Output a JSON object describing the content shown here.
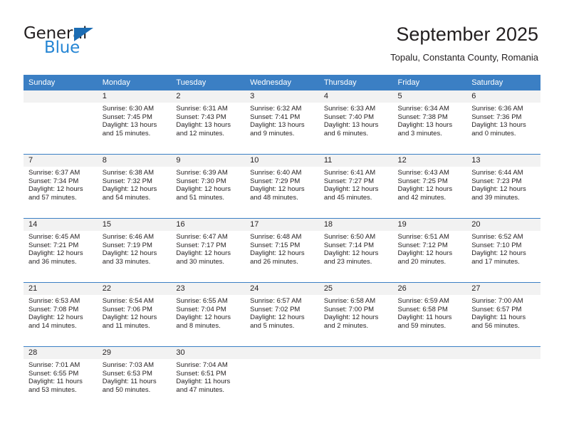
{
  "brand": {
    "name_part1": "General",
    "name_part2": "Blue",
    "accent_color": "#2585d4",
    "triangle_color": "#1b6cb3"
  },
  "header": {
    "title": "September 2025",
    "location": "Topalu, Constanta County, Romania"
  },
  "theme": {
    "header_blue": "#3b7fc4",
    "daynum_band": "#f2f2f2",
    "text": "#231f20"
  },
  "calendar": {
    "weekday_headers": [
      "Sunday",
      "Monday",
      "Tuesday",
      "Wednesday",
      "Thursday",
      "Friday",
      "Saturday"
    ],
    "weeks": [
      [
        {
          "day": "",
          "sunrise": "",
          "sunset": "",
          "daylight": "",
          "empty": true
        },
        {
          "day": "1",
          "sunrise": "Sunrise: 6:30 AM",
          "sunset": "Sunset: 7:45 PM",
          "daylight": "Daylight: 13 hours and 15 minutes."
        },
        {
          "day": "2",
          "sunrise": "Sunrise: 6:31 AM",
          "sunset": "Sunset: 7:43 PM",
          "daylight": "Daylight: 13 hours and 12 minutes."
        },
        {
          "day": "3",
          "sunrise": "Sunrise: 6:32 AM",
          "sunset": "Sunset: 7:41 PM",
          "daylight": "Daylight: 13 hours and 9 minutes."
        },
        {
          "day": "4",
          "sunrise": "Sunrise: 6:33 AM",
          "sunset": "Sunset: 7:40 PM",
          "daylight": "Daylight: 13 hours and 6 minutes."
        },
        {
          "day": "5",
          "sunrise": "Sunrise: 6:34 AM",
          "sunset": "Sunset: 7:38 PM",
          "daylight": "Daylight: 13 hours and 3 minutes."
        },
        {
          "day": "6",
          "sunrise": "Sunrise: 6:36 AM",
          "sunset": "Sunset: 7:36 PM",
          "daylight": "Daylight: 13 hours and 0 minutes."
        }
      ],
      [
        {
          "day": "7",
          "sunrise": "Sunrise: 6:37 AM",
          "sunset": "Sunset: 7:34 PM",
          "daylight": "Daylight: 12 hours and 57 minutes."
        },
        {
          "day": "8",
          "sunrise": "Sunrise: 6:38 AM",
          "sunset": "Sunset: 7:32 PM",
          "daylight": "Daylight: 12 hours and 54 minutes."
        },
        {
          "day": "9",
          "sunrise": "Sunrise: 6:39 AM",
          "sunset": "Sunset: 7:30 PM",
          "daylight": "Daylight: 12 hours and 51 minutes."
        },
        {
          "day": "10",
          "sunrise": "Sunrise: 6:40 AM",
          "sunset": "Sunset: 7:29 PM",
          "daylight": "Daylight: 12 hours and 48 minutes."
        },
        {
          "day": "11",
          "sunrise": "Sunrise: 6:41 AM",
          "sunset": "Sunset: 7:27 PM",
          "daylight": "Daylight: 12 hours and 45 minutes."
        },
        {
          "day": "12",
          "sunrise": "Sunrise: 6:43 AM",
          "sunset": "Sunset: 7:25 PM",
          "daylight": "Daylight: 12 hours and 42 minutes."
        },
        {
          "day": "13",
          "sunrise": "Sunrise: 6:44 AM",
          "sunset": "Sunset: 7:23 PM",
          "daylight": "Daylight: 12 hours and 39 minutes."
        }
      ],
      [
        {
          "day": "14",
          "sunrise": "Sunrise: 6:45 AM",
          "sunset": "Sunset: 7:21 PM",
          "daylight": "Daylight: 12 hours and 36 minutes."
        },
        {
          "day": "15",
          "sunrise": "Sunrise: 6:46 AM",
          "sunset": "Sunset: 7:19 PM",
          "daylight": "Daylight: 12 hours and 33 minutes."
        },
        {
          "day": "16",
          "sunrise": "Sunrise: 6:47 AM",
          "sunset": "Sunset: 7:17 PM",
          "daylight": "Daylight: 12 hours and 30 minutes."
        },
        {
          "day": "17",
          "sunrise": "Sunrise: 6:48 AM",
          "sunset": "Sunset: 7:15 PM",
          "daylight": "Daylight: 12 hours and 26 minutes."
        },
        {
          "day": "18",
          "sunrise": "Sunrise: 6:50 AM",
          "sunset": "Sunset: 7:14 PM",
          "daylight": "Daylight: 12 hours and 23 minutes."
        },
        {
          "day": "19",
          "sunrise": "Sunrise: 6:51 AM",
          "sunset": "Sunset: 7:12 PM",
          "daylight": "Daylight: 12 hours and 20 minutes."
        },
        {
          "day": "20",
          "sunrise": "Sunrise: 6:52 AM",
          "sunset": "Sunset: 7:10 PM",
          "daylight": "Daylight: 12 hours and 17 minutes."
        }
      ],
      [
        {
          "day": "21",
          "sunrise": "Sunrise: 6:53 AM",
          "sunset": "Sunset: 7:08 PM",
          "daylight": "Daylight: 12 hours and 14 minutes."
        },
        {
          "day": "22",
          "sunrise": "Sunrise: 6:54 AM",
          "sunset": "Sunset: 7:06 PM",
          "daylight": "Daylight: 12 hours and 11 minutes."
        },
        {
          "day": "23",
          "sunrise": "Sunrise: 6:55 AM",
          "sunset": "Sunset: 7:04 PM",
          "daylight": "Daylight: 12 hours and 8 minutes."
        },
        {
          "day": "24",
          "sunrise": "Sunrise: 6:57 AM",
          "sunset": "Sunset: 7:02 PM",
          "daylight": "Daylight: 12 hours and 5 minutes."
        },
        {
          "day": "25",
          "sunrise": "Sunrise: 6:58 AM",
          "sunset": "Sunset: 7:00 PM",
          "daylight": "Daylight: 12 hours and 2 minutes."
        },
        {
          "day": "26",
          "sunrise": "Sunrise: 6:59 AM",
          "sunset": "Sunset: 6:58 PM",
          "daylight": "Daylight: 11 hours and 59 minutes."
        },
        {
          "day": "27",
          "sunrise": "Sunrise: 7:00 AM",
          "sunset": "Sunset: 6:57 PM",
          "daylight": "Daylight: 11 hours and 56 minutes."
        }
      ],
      [
        {
          "day": "28",
          "sunrise": "Sunrise: 7:01 AM",
          "sunset": "Sunset: 6:55 PM",
          "daylight": "Daylight: 11 hours and 53 minutes."
        },
        {
          "day": "29",
          "sunrise": "Sunrise: 7:03 AM",
          "sunset": "Sunset: 6:53 PM",
          "daylight": "Daylight: 11 hours and 50 minutes."
        },
        {
          "day": "30",
          "sunrise": "Sunrise: 7:04 AM",
          "sunset": "Sunset: 6:51 PM",
          "daylight": "Daylight: 11 hours and 47 minutes."
        },
        {
          "day": "",
          "sunrise": "",
          "sunset": "",
          "daylight": "",
          "empty": true
        },
        {
          "day": "",
          "sunrise": "",
          "sunset": "",
          "daylight": "",
          "empty": true
        },
        {
          "day": "",
          "sunrise": "",
          "sunset": "",
          "daylight": "",
          "empty": true
        },
        {
          "day": "",
          "sunrise": "",
          "sunset": "",
          "daylight": "",
          "empty": true
        }
      ]
    ]
  }
}
